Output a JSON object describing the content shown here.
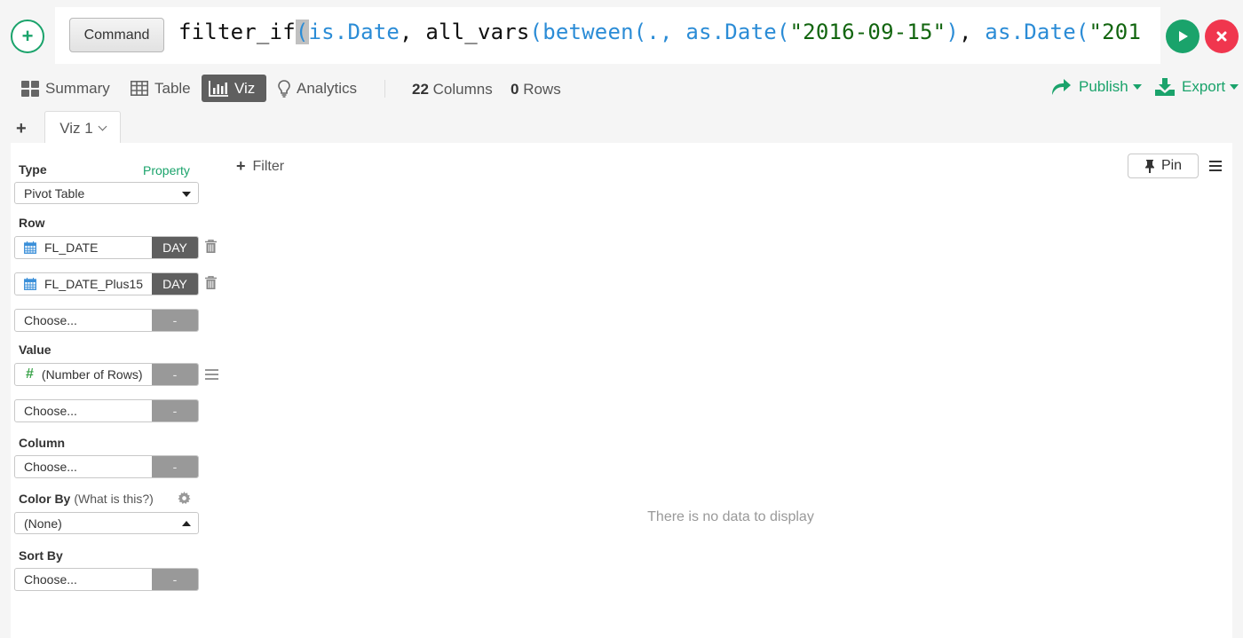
{
  "command_bar": {
    "add_icon": "plus-circle-icon",
    "command_button_label": "Command",
    "code_segments": [
      {
        "text": "filter_if",
        "color": "default"
      },
      {
        "text": "(",
        "color": "blue",
        "cursor": true
      },
      {
        "text": "is.Date",
        "color": "blue"
      },
      {
        "text": ", all_vars",
        "color": "default"
      },
      {
        "text": "(between(., as.Date(",
        "color": "blue"
      },
      {
        "text": "\"2016-09-15\"",
        "color": "green"
      },
      {
        "text": ")",
        "color": "blue"
      },
      {
        "text": ", ",
        "color": "default"
      },
      {
        "text": "as.Date(",
        "color": "blue"
      },
      {
        "text": "\"201",
        "color": "green"
      }
    ],
    "run_icon": "play-icon",
    "cancel_icon": "close-icon"
  },
  "nav": {
    "items": [
      {
        "label": "Summary",
        "icon": "summary-grid-icon",
        "active": false
      },
      {
        "label": "Table",
        "icon": "table-icon",
        "active": false
      },
      {
        "label": "Viz",
        "icon": "bar-chart-icon",
        "active": true
      },
      {
        "label": "Analytics",
        "icon": "lightbulb-icon",
        "active": false
      }
    ],
    "columns_count": "22",
    "columns_label": "Columns",
    "rows_count": "0",
    "rows_label": "Rows",
    "publish_label": "Publish",
    "export_label": "Export"
  },
  "viz_tabs": {
    "add_label": "+",
    "tabs": [
      {
        "label": "Viz 1"
      }
    ]
  },
  "config": {
    "type_label": "Type",
    "property_link": "Property",
    "type_value": "Pivot Table",
    "row_label": "Row",
    "rows": [
      {
        "name": "FL_DATE",
        "agg": "DAY",
        "icon": "calendar-icon"
      },
      {
        "name": "FL_DATE_Plus15",
        "agg": "DAY",
        "icon": "calendar-icon"
      }
    ],
    "row_choose": {
      "name": "Choose...",
      "agg": "-"
    },
    "value_label": "Value",
    "values": [
      {
        "name": "(Number of Rows)",
        "agg": "-",
        "icon": "hash-icon"
      }
    ],
    "value_choose": {
      "name": "Choose...",
      "agg": "-"
    },
    "column_label": "Column",
    "column_choose": {
      "name": "Choose...",
      "agg": "-"
    },
    "color_by_label": "Color By",
    "color_by_help": "(What is this?)",
    "color_by_value": "(None)",
    "sort_by_label": "Sort By",
    "sort_choose": {
      "name": "Choose...",
      "agg": "-"
    }
  },
  "canvas": {
    "filter_label": "Filter",
    "pin_label": "Pin",
    "empty_message": "There is no data to display"
  },
  "colors": {
    "accent_green": "#1aa36b",
    "danger_red": "#f0364e",
    "code_blue": "#2b8cd6",
    "code_string_green": "#12650f",
    "active_tab_bg": "#5f5f5f"
  }
}
